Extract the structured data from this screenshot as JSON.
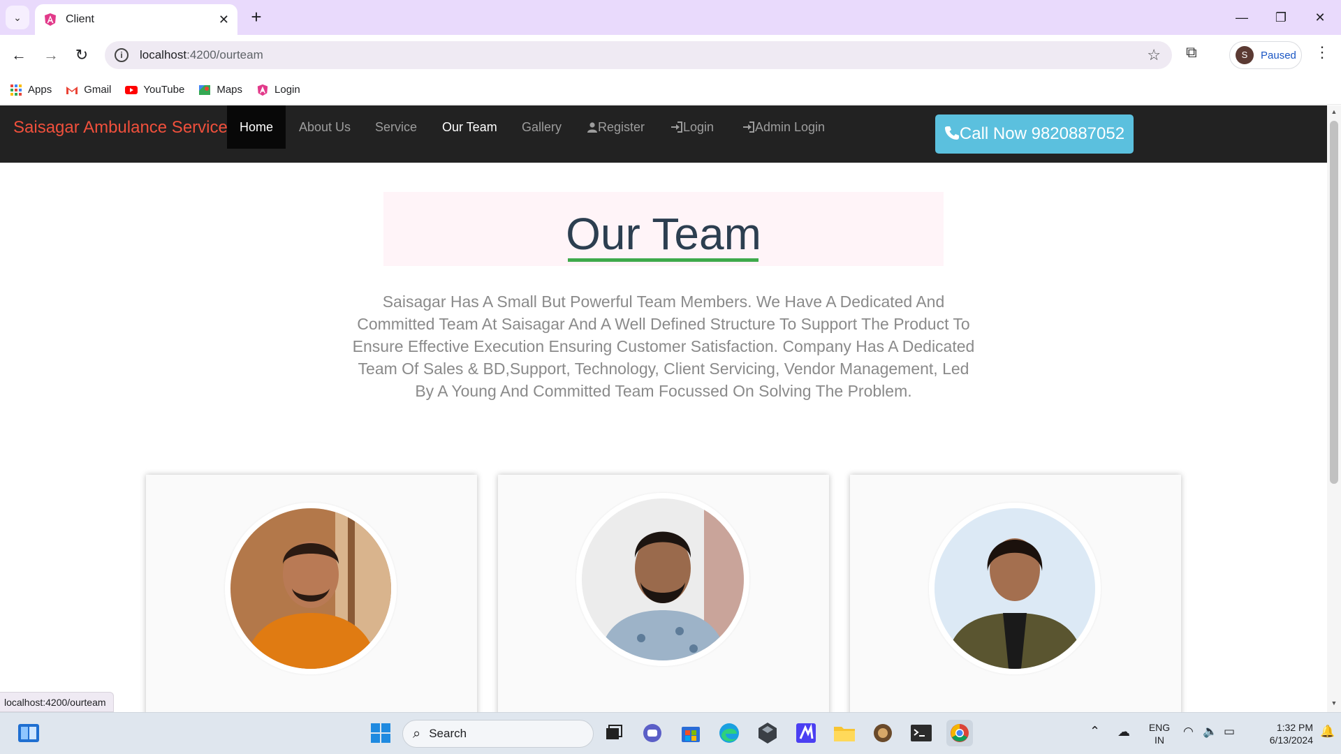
{
  "browser": {
    "tab_title": "Client",
    "url_host": "localhost",
    "url_rest": ":4200/ourteam",
    "profile_initial": "S",
    "profile_status": "Paused",
    "bookmarks": [
      "Apps",
      "Gmail",
      "YouTube",
      "Maps",
      "Login"
    ],
    "status_url": "localhost:4200/ourteam"
  },
  "site": {
    "brand": "Saisagar Ambulance Service",
    "nav": [
      "Home",
      "About Us",
      "Service",
      "Our Team",
      "Gallery",
      "Register",
      "Login",
      "Admin Login"
    ],
    "active_nav": "Home",
    "current_nav": "Our Team",
    "call_button": "Call Now 9820887052",
    "heading": "Our Team",
    "intro": "Saisagar Has A Small But Powerful Team Members. We Have A Dedicated And Committed Team At Saisagar And A Well Defined Structure To Support The Product To Ensure Effective Execution Ensuring Customer Satisfaction. Company Has A Dedicated Team Of Sales & BD,Support, Technology, Client Servicing, Vendor Management, Led By A Young And Committed Team Focussed On Solving The Problem.",
    "colors": {
      "navbar": "#222222",
      "brand": "#f0503c",
      "call_button": "#5bc0de",
      "heading_underline": "#3fa94b"
    }
  },
  "taskbar": {
    "search_placeholder": "Search",
    "lang_top": "ENG",
    "lang_bottom": "IN",
    "time": "1:32 PM",
    "date": "6/13/2024"
  }
}
